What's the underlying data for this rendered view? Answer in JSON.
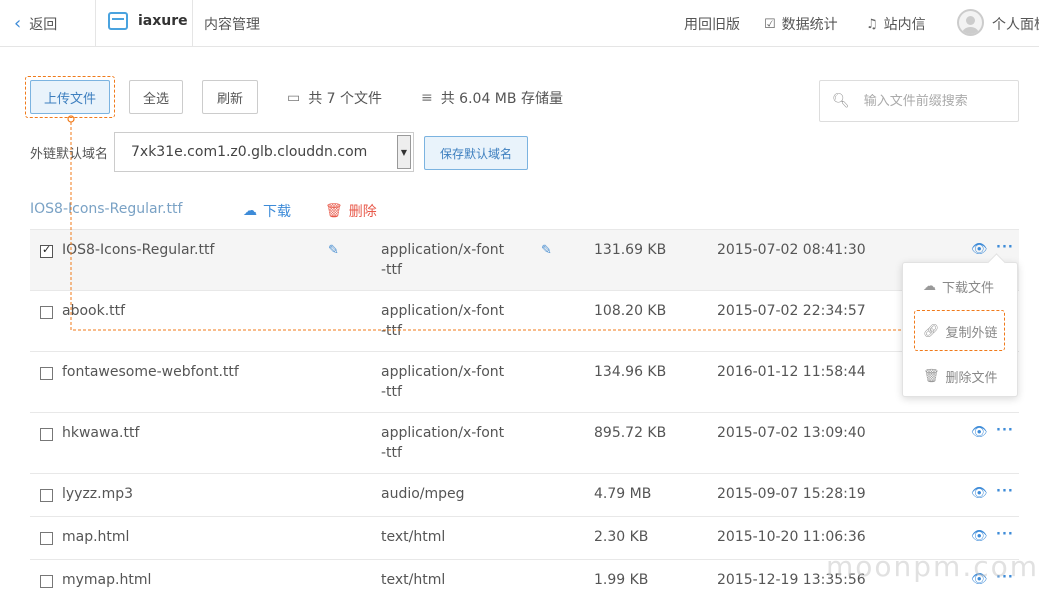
{
  "nav": {
    "back_label": "返回",
    "bucket_name": "iaxure",
    "section_title": "内容管理",
    "old_version": "用回旧版",
    "stats": "数据统计",
    "messages": "站内信",
    "panel": "个人面板"
  },
  "toolbar": {
    "upload_label": "上传文件",
    "select_all_label": "全选",
    "refresh_label": "刷新",
    "file_count": "共 7 个文件",
    "storage": "共 6.04 MB 存储量",
    "search_placeholder": "输入文件前缀搜索"
  },
  "domain": {
    "label": "外链默认域名",
    "value": "7xk31e.com1.z0.glb.clouddn.com",
    "save_label": "保存默认域名"
  },
  "selection": {
    "name": "IOS8-Icons-Regular.ttf",
    "download_label": "下载",
    "delete_label": "删除"
  },
  "files": [
    {
      "name": "IOS8-Icons-Regular.ttf",
      "type_line1": "application/x-font",
      "type_line2": "-ttf",
      "size": "131.69 KB",
      "date": "2015-07-02 08:41:30",
      "checked": true
    },
    {
      "name": "abook.ttf",
      "type_line1": "application/x-font",
      "type_line2": "-ttf",
      "size": "108.20 KB",
      "date": "2015-07-02 22:34:57",
      "checked": false
    },
    {
      "name": "fontawesome-webfont.ttf",
      "type_line1": "application/x-font",
      "type_line2": "-ttf",
      "size": "134.96 KB",
      "date": "2016-01-12 11:58:44",
      "checked": false
    },
    {
      "name": "hkwawa.ttf",
      "type_line1": "application/x-font",
      "type_line2": "-ttf",
      "size": "895.72 KB",
      "date": "2015-07-02 13:09:40",
      "checked": false
    },
    {
      "name": "lyyzz.mp3",
      "type_line1": "audio/mpeg",
      "type_line2": "",
      "size": "4.79 MB",
      "date": "2015-09-07 15:28:19",
      "checked": false
    },
    {
      "name": "map.html",
      "type_line1": "text/html",
      "type_line2": "",
      "size": "2.30 KB",
      "date": "2015-10-20 11:06:36",
      "checked": false
    },
    {
      "name": "mymap.html",
      "type_line1": "text/html",
      "type_line2": "",
      "size": "1.99 KB",
      "date": "2015-12-19 13:35:56",
      "checked": false
    }
  ],
  "menu": {
    "download": "下载文件",
    "copy_link": "复制外链",
    "delete": "删除文件"
  },
  "watermark": "moonpm.com",
  "colors": {
    "accent": "#3d8bd8",
    "annotation": "#f07a1a",
    "danger": "#e8594a"
  }
}
